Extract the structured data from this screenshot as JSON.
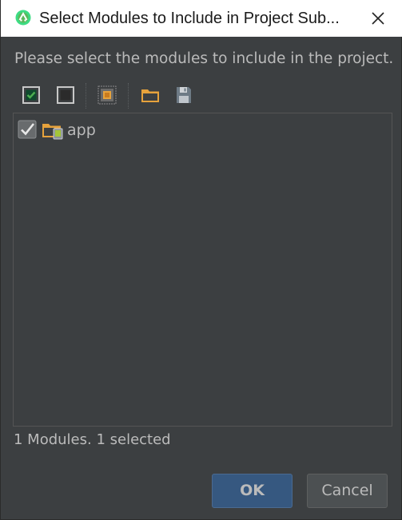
{
  "window": {
    "title": "Select Modules to Include in Project Sub...",
    "app_icon": "android-studio-icon",
    "close_icon": "close-icon"
  },
  "prompt": "Please select the modules to include in the project.",
  "toolbar": {
    "buttons": [
      {
        "name": "select-all-button",
        "icon": "checkbox-checked-icon"
      },
      {
        "name": "unselect-all-button",
        "icon": "checkbox-empty-icon"
      },
      {
        "name": "select-module-dependencies-button",
        "icon": "module-dependencies-icon"
      },
      {
        "name": "browse-folder-button",
        "icon": "folder-icon"
      },
      {
        "name": "save-selection-button",
        "icon": "floppy-save-icon"
      }
    ]
  },
  "modules": [
    {
      "label": "app",
      "checked": true,
      "icon": "android-module-folder-icon"
    }
  ],
  "status": "1 Modules. 1 selected",
  "buttons": {
    "ok": "OK",
    "cancel": "Cancel"
  },
  "colors": {
    "background": "#3c3f41",
    "text": "#bbbbbb",
    "ok_button": "#365880",
    "cancel_button": "#4c5052",
    "checkmark_green": "#4caf50",
    "folder_orange": "#e6a23c"
  }
}
